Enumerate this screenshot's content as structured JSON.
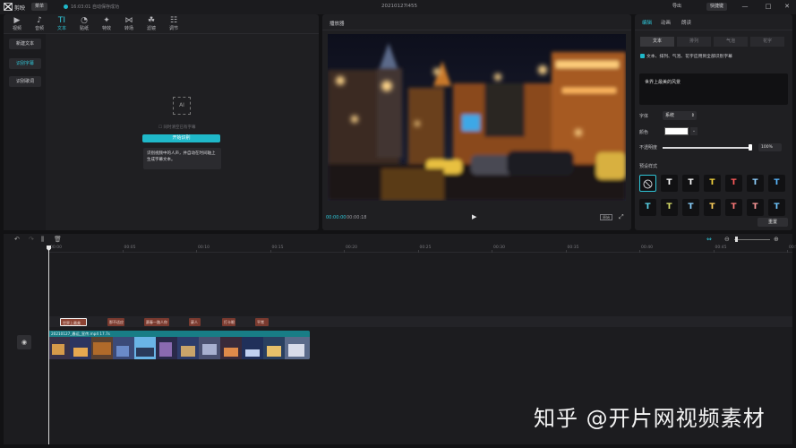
{
  "titlebar": {
    "app_name": "剪映",
    "menu_label": "菜单",
    "save_status": "16:03:01 自动保存成功",
    "project_title": "20210127l455",
    "export_label": "导出",
    "shortcut_label": "快捷键",
    "window_controls": [
      "—",
      "□",
      "✕"
    ]
  },
  "media_toolbar": [
    {
      "label": "视频",
      "icon": "▶"
    },
    {
      "label": "音频",
      "icon": "♪"
    },
    {
      "label": "文本",
      "icon": "TI"
    },
    {
      "label": "贴纸",
      "icon": "◔"
    },
    {
      "label": "特效",
      "icon": "✦"
    },
    {
      "label": "转场",
      "icon": "⋈"
    },
    {
      "label": "滤镜",
      "icon": "☘"
    },
    {
      "label": "调节",
      "icon": "☷"
    }
  ],
  "side_menu": [
    "新建文本",
    "识别字幕",
    "识别歌词"
  ],
  "recognition": {
    "ai_icon_text": "AI",
    "clear_existing": "同时清空已有字幕",
    "start_button": "开始识别",
    "tip": "识别视频中的人声，并自动在时间轴上生成字幕文本。"
  },
  "player": {
    "title": "播放器",
    "current_time": "00:00:00",
    "total_time": "00:00:18",
    "ratio_label": "原始"
  },
  "inspector": {
    "tabs": [
      "编辑",
      "动画",
      "朗读"
    ],
    "subtabs": [
      "文本",
      "排列",
      "气泡",
      "花字"
    ],
    "apply_all": "文本、排列、气泡、花字应用到全部识别字幕",
    "text_value": "世界上最美的风景",
    "font_label": "字体",
    "font_value": "系统",
    "color_label": "颜色",
    "color_value": "#FFFFFF",
    "opacity_label": "不透明度",
    "opacity_value": "100%",
    "presets_label": "预设样式",
    "reset_label": "重置",
    "preset_colors": [
      "#ffffff",
      "#ffffff",
      "#f2d23c",
      "#ff5a5a",
      "#8fd0ff",
      "#59b8ff",
      "#59d4e8",
      "#dbe06a",
      "#8ad2ff",
      "#ffd15c",
      "#ff7a7a",
      "#ff9a9a",
      "#6fc7ff"
    ]
  },
  "timeline": {
    "ticks": [
      "00:00",
      "00:05",
      "00:10",
      "00:15",
      "00:20",
      "00:25",
      "00:30",
      "00:35",
      "00:40",
      "00:45",
      "00:50"
    ],
    "text_clips": [
      "世界上最美",
      "那不适应",
      "赛春一路人你",
      "豪人",
      "打卡眼",
      "平常"
    ],
    "main_clip_label": "20210127_春运_宣传.mp4   17.7s"
  },
  "watermark": "知乎 @开片网视频素材"
}
